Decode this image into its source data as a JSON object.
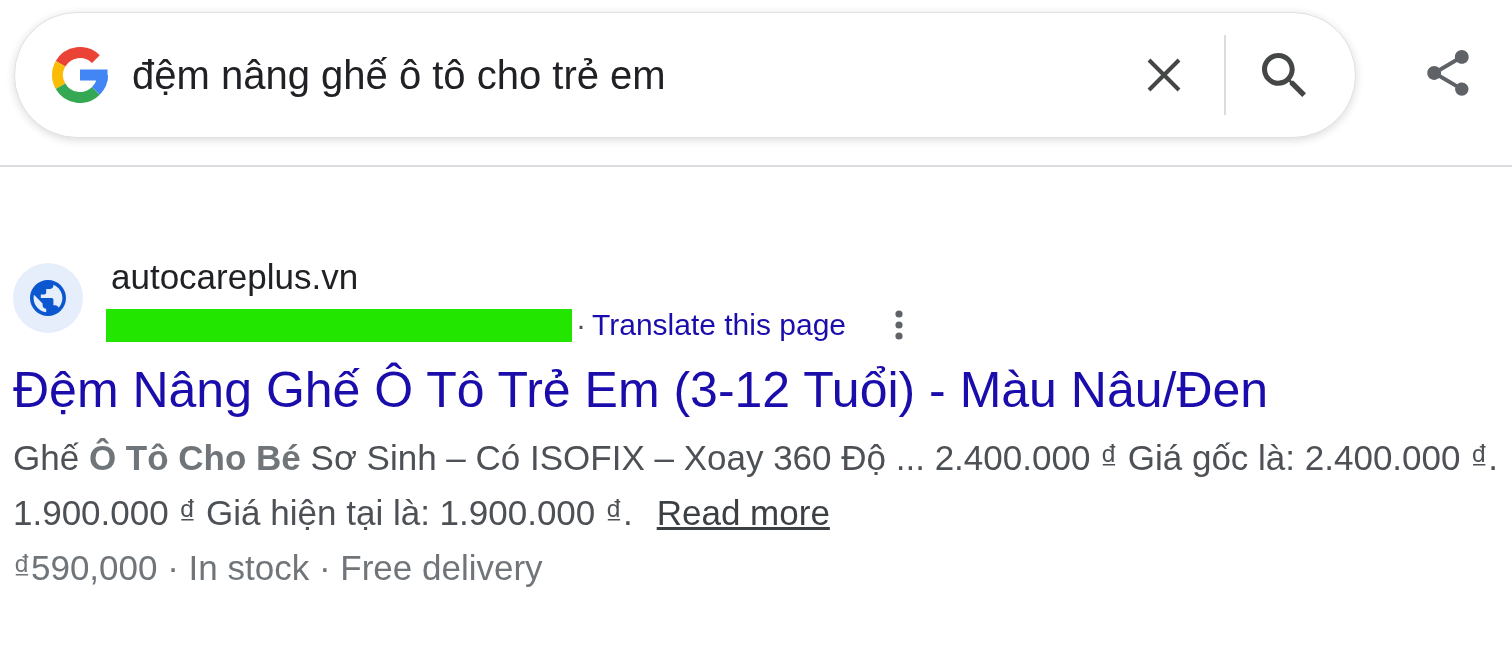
{
  "search": {
    "query": "đệm nâng ghế ô tô cho trẻ em"
  },
  "result": {
    "site_name": "autocareplus.vn",
    "separator": "·",
    "translate_link": "Translate this page",
    "title": "Đệm Nâng Ghế Ô Tô Trẻ Em (3-12 Tuổi) - Màu Nâu/Đen",
    "snippet": "Ghế **Ô Tô Cho Bé** Sơ Sinh – Có ISOFIX – Xoay 360 Độ ... 2.400.000 ₫ Giá gốc là: 2.400.000 ₫. 1.900.000 ₫ Giá hiện tại là: 1.900.000 ₫.",
    "read_more": "Read more",
    "details": "₫590,000 · In stock · Free delivery"
  }
}
